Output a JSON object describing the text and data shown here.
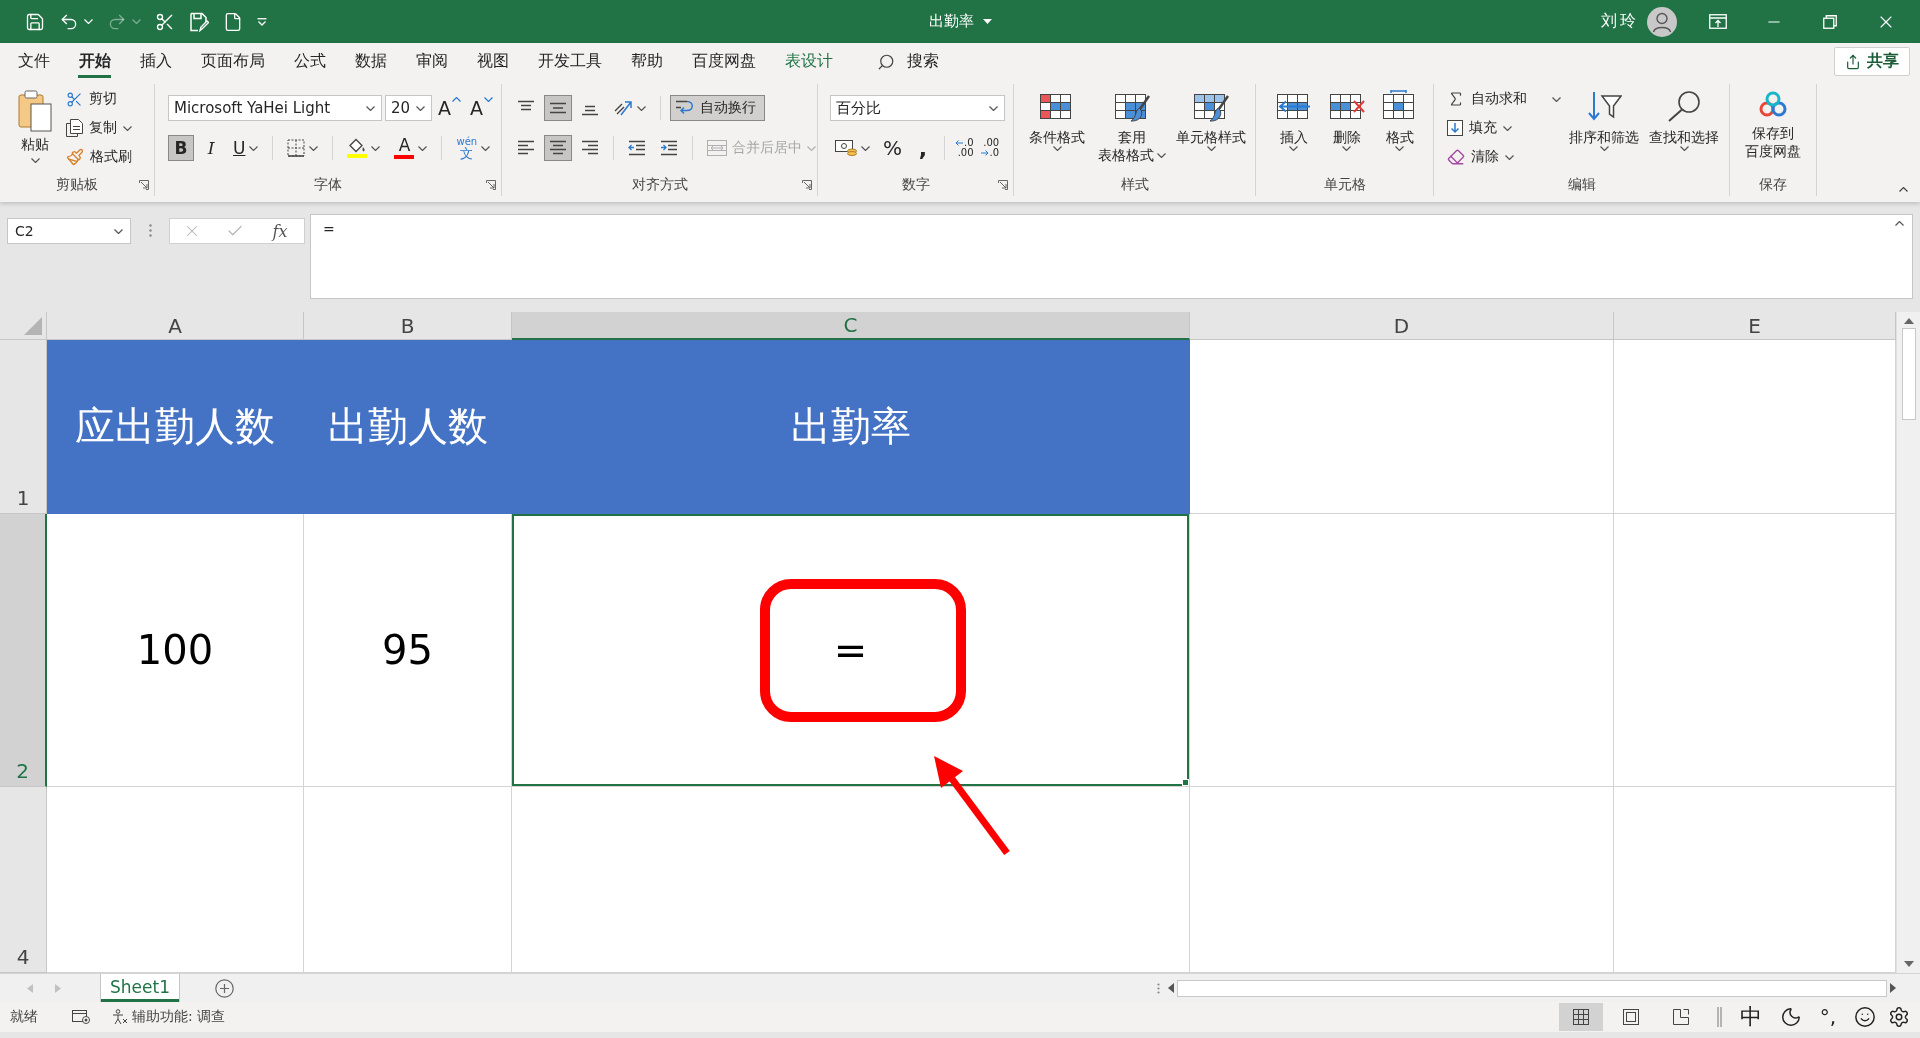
{
  "title_bar": {
    "quick_access": [
      {
        "kind": "save",
        "disabled": false
      },
      {
        "kind": "undo",
        "disabled": false
      },
      {
        "kind": "redo",
        "disabled": true
      },
      {
        "kind": "cut",
        "disabled": false
      },
      {
        "kind": "form",
        "disabled": false
      },
      {
        "kind": "new",
        "disabled": false
      },
      {
        "kind": "customize",
        "disabled": false
      }
    ],
    "title": "出勤率",
    "user": "刘玲"
  },
  "ribbon_tabs": [
    {
      "label": "文件",
      "selected": false,
      "kind": "normal"
    },
    {
      "label": "开始",
      "selected": true,
      "kind": "normal"
    },
    {
      "label": "插入",
      "selected": false,
      "kind": "normal"
    },
    {
      "label": "页面布局",
      "selected": false,
      "kind": "normal"
    },
    {
      "label": "公式",
      "selected": false,
      "kind": "normal"
    },
    {
      "label": "数据",
      "selected": false,
      "kind": "normal"
    },
    {
      "label": "审阅",
      "selected": false,
      "kind": "normal"
    },
    {
      "label": "视图",
      "selected": false,
      "kind": "normal"
    },
    {
      "label": "开发工具",
      "selected": false,
      "kind": "normal"
    },
    {
      "label": "帮助",
      "selected": false,
      "kind": "normal"
    },
    {
      "label": "百度网盘",
      "selected": false,
      "kind": "normal"
    },
    {
      "label": "表设计",
      "selected": false,
      "kind": "contextual"
    }
  ],
  "search": {
    "label": "搜索"
  },
  "share_button": "共享",
  "ribbon_groups": [
    {
      "kind": "clipboard",
      "label": "剪贴板",
      "launcher": true,
      "paste": "粘贴",
      "items": [
        {
          "kind": "cut",
          "label": "剪切",
          "menu": false
        },
        {
          "kind": "copy",
          "label": "复制",
          "menu": true
        },
        {
          "kind": "format_painter",
          "label": "格式刷",
          "menu": false
        }
      ]
    },
    {
      "kind": "font",
      "label": "字体",
      "launcher": true,
      "font_name": "Microsoft YaHei Light",
      "font_size": "20",
      "size_buttons": [
        {
          "kind": "grow",
          "glyph": "A"
        },
        {
          "kind": "shrink",
          "glyph": "A"
        }
      ],
      "styles": [
        {
          "kind": "bold",
          "glyph": "B",
          "selected": true,
          "menu": false
        },
        {
          "kind": "italic",
          "glyph": "I",
          "selected": false,
          "menu": false
        },
        {
          "kind": "underline",
          "glyph": "U",
          "selected": false,
          "menu": true
        }
      ],
      "fill_color": {
        "color": "#ffff00"
      },
      "font_color": {
        "glyph": "A",
        "color": "#ff0000"
      },
      "phonetic": {
        "top": "wén",
        "bottom": "文"
      }
    },
    {
      "kind": "alignment",
      "label": "对齐方式",
      "launcher": true,
      "vertical": [
        {
          "kind": "top",
          "selected": false
        },
        {
          "kind": "middle",
          "selected": true
        },
        {
          "kind": "bottom",
          "selected": false
        }
      ],
      "horizontal": [
        {
          "kind": "left",
          "selected": false
        },
        {
          "kind": "center",
          "selected": true
        },
        {
          "kind": "right",
          "selected": false
        }
      ],
      "wrap_text": {
        "label": "自动换行",
        "selected": true
      },
      "merge": {
        "label": "合并后居中",
        "disabled": true
      }
    },
    {
      "kind": "number",
      "label": "数字",
      "launcher": true,
      "format": "百分比",
      "percent": "%",
      "comma": ",",
      "decimals": [
        {
          "kind": "increase",
          "top": ".0",
          "bottom": ".00"
        },
        {
          "kind": "decrease",
          "top": ".00",
          "bottom": ".0"
        }
      ]
    },
    {
      "kind": "large",
      "label": "样式",
      "launcher": false,
      "buttons": [
        {
          "kind": "conditional_format",
          "lines": [
            "条件格式"
          ],
          "menu": true
        },
        {
          "kind": "table_format",
          "lines": [
            "套用",
            "表格格式"
          ],
          "menu": true
        },
        {
          "kind": "cell_styles",
          "lines": [
            "单元格样式"
          ],
          "menu": true
        }
      ]
    },
    {
      "kind": "large",
      "label": "单元格",
      "launcher": false,
      "buttons": [
        {
          "kind": "insert",
          "lines": [
            "插入"
          ],
          "menu": true
        },
        {
          "kind": "delete",
          "lines": [
            "删除"
          ],
          "menu": true
        },
        {
          "kind": "format",
          "lines": [
            "格式"
          ],
          "menu": true
        }
      ]
    },
    {
      "kind": "editing",
      "label": "编辑",
      "launcher": false,
      "items": [
        {
          "kind": "autosum",
          "label": "自动求和",
          "menu": true
        },
        {
          "kind": "fill",
          "label": "填充",
          "menu": true
        },
        {
          "kind": "clear",
          "label": "清除",
          "menu": true
        }
      ],
      "buttons": [
        {
          "kind": "sort_filter",
          "lines": [
            "排序和筛选"
          ],
          "menu": true
        },
        {
          "kind": "find_select",
          "lines": [
            "查找和选择"
          ],
          "menu": true
        }
      ]
    },
    {
      "kind": "large",
      "label": "保存",
      "launcher": false,
      "buttons": [
        {
          "kind": "cloud_save",
          "lines": [
            "保存到",
            "百度网盘"
          ],
          "menu": false
        }
      ]
    }
  ],
  "formula_bar": {
    "name_box": "C2",
    "function_glyph": "fx",
    "formula": "="
  },
  "columns": [
    {
      "label": "A",
      "selected": false
    },
    {
      "label": "B",
      "selected": false
    },
    {
      "label": "C",
      "selected": true
    },
    {
      "label": "D",
      "selected": false
    },
    {
      "label": "E",
      "selected": false
    }
  ],
  "rows": [
    {
      "label": "1",
      "kind": "header",
      "selected": false,
      "cells": [
        {
          "text": "应出勤人数",
          "selected": false
        },
        {
          "text": "出勤人数",
          "selected": false
        },
        {
          "text": "出勤率",
          "selected": false
        }
      ]
    },
    {
      "label": "2",
      "kind": "data",
      "selected": true,
      "cells": [
        {
          "text": "100",
          "selected": false
        },
        {
          "text": "95",
          "selected": false
        },
        {
          "text": "=",
          "selected": true
        }
      ]
    },
    {
      "label": "4",
      "kind": "blank",
      "selected": false
    }
  ],
  "annotations": [
    {
      "kind": "frame"
    },
    {
      "kind": "arrow"
    }
  ],
  "sheet_tabs": [
    {
      "label": "Sheet1",
      "selected": true
    }
  ],
  "status_bar": {
    "status": "就绪",
    "accessibility": "辅助功能: 调查",
    "views": [
      {
        "kind": "normal",
        "selected": true
      },
      {
        "kind": "page_layout",
        "selected": false
      },
      {
        "kind": "page_break",
        "selected": false
      }
    ],
    "ime": [
      {
        "kind": "input_mode",
        "label": "中"
      },
      {
        "kind": "moon"
      },
      {
        "kind": "punctuation",
        "label": "°,"
      },
      {
        "kind": "emoji"
      },
      {
        "kind": "settings"
      }
    ]
  }
}
